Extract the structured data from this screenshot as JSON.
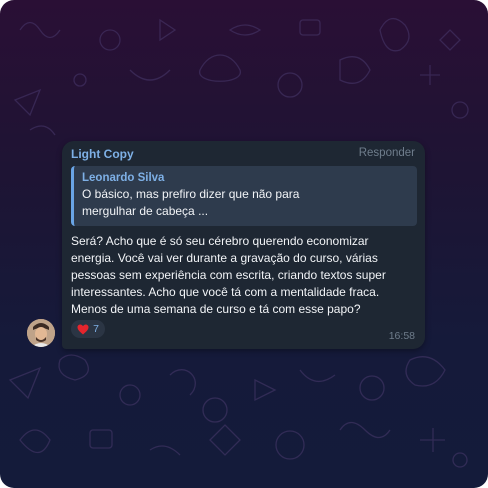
{
  "message": {
    "sender": "Light Copy",
    "reply_label": "Responder",
    "quote": {
      "author": "Leonardo Silva",
      "lines": [
        "O básico, mas prefiro dizer que não para",
        "mergulhar de cabeça ..."
      ]
    },
    "lines": [
      "Será? Acho que é só seu cérebro querendo economizar",
      "energia. Você vai ver durante a gravação do curso, várias",
      "pessoas sem experiência com escrita, criando textos super",
      "interessantes. Acho que você tá com a mentalidade fraca.",
      "Menos de uma semana de curso e tá com esse papo?"
    ],
    "reaction": {
      "icon": "heart-icon",
      "count": "7"
    },
    "time": "16:58"
  },
  "colors": {
    "bubble": "#1e2733",
    "accent": "#7eb0e6",
    "quote_bg": "#2e3b4d",
    "heart": "#e5252d"
  }
}
